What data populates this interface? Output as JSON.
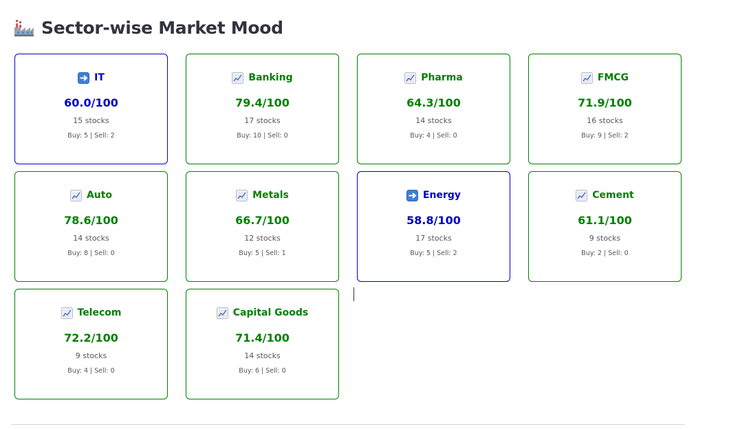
{
  "header": {
    "icon": "factory-icon",
    "title": "Sector-wise Market Mood"
  },
  "colors": {
    "bullish": "#008000",
    "neutral": "#0000cc"
  },
  "sectors": [
    {
      "name": "IT",
      "trend": "neutral",
      "icon": "right-arrow-icon",
      "score": "60.0/100",
      "stocks": "15 stocks",
      "buysell": "Buy: 5 | Sell: 2"
    },
    {
      "name": "Banking",
      "trend": "bullish",
      "icon": "chart-increasing-icon",
      "score": "79.4/100",
      "stocks": "17 stocks",
      "buysell": "Buy: 10 | Sell: 0"
    },
    {
      "name": "Pharma",
      "trend": "bullish",
      "icon": "chart-increasing-icon",
      "score": "64.3/100",
      "stocks": "14 stocks",
      "buysell": "Buy: 4 | Sell: 0"
    },
    {
      "name": "FMCG",
      "trend": "bullish",
      "icon": "chart-increasing-icon",
      "score": "71.9/100",
      "stocks": "16 stocks",
      "buysell": "Buy: 9 | Sell: 2"
    },
    {
      "name": "Auto",
      "trend": "bullish",
      "icon": "chart-increasing-icon",
      "score": "78.6/100",
      "stocks": "14 stocks",
      "buysell": "Buy: 8 | Sell: 0"
    },
    {
      "name": "Metals",
      "trend": "bullish",
      "icon": "chart-increasing-icon",
      "score": "66.7/100",
      "stocks": "12 stocks",
      "buysell": "Buy: 5 | Sell: 1"
    },
    {
      "name": "Energy",
      "trend": "neutral",
      "icon": "right-arrow-icon",
      "score": "58.8/100",
      "stocks": "17 stocks",
      "buysell": "Buy: 5 | Sell: 2"
    },
    {
      "name": "Cement",
      "trend": "bullish",
      "icon": "chart-increasing-icon",
      "score": "61.1/100",
      "stocks": "9 stocks",
      "buysell": "Buy: 2 | Sell: 0"
    },
    {
      "name": "Telecom",
      "trend": "bullish",
      "icon": "chart-increasing-icon",
      "score": "72.2/100",
      "stocks": "9 stocks",
      "buysell": "Buy: 4 | Sell: 0"
    },
    {
      "name": "Capital Goods",
      "trend": "bullish",
      "icon": "chart-increasing-icon",
      "score": "71.4/100",
      "stocks": "14 stocks",
      "buysell": "Buy: 6 | Sell: 0"
    }
  ]
}
